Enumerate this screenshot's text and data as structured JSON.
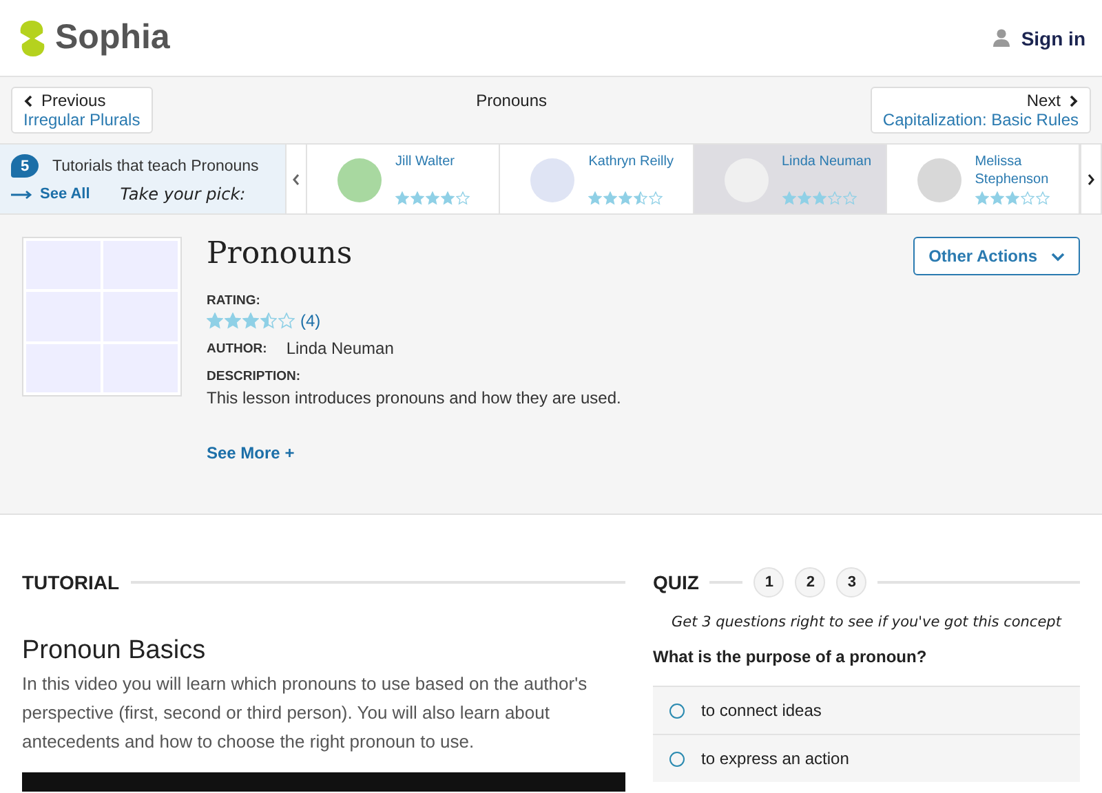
{
  "header": {
    "logo": "Sophia",
    "sign_in": "Sign in"
  },
  "nav": {
    "previous": {
      "label": "Previous",
      "title": "Irregular Plurals"
    },
    "current": "Pronouns",
    "next": {
      "label": "Next",
      "title": "Capitalization: Basic Rules"
    }
  },
  "tutorials": {
    "count": "5",
    "heading": "Tutorials that teach Pronouns",
    "see_all": "See All",
    "tagline": "Take your pick:",
    "items": [
      {
        "author": "Jill Walter",
        "stars": 4,
        "selected": false
      },
      {
        "author": "Kathryn Reilly",
        "stars": 3.5,
        "selected": false
      },
      {
        "author": "Linda Neuman",
        "stars": 3,
        "selected": true
      },
      {
        "author": "Melissa Stephenson",
        "stars": 3,
        "selected": false
      }
    ]
  },
  "lesson": {
    "title": "Pronouns",
    "rating_label": "RATING:",
    "stars": 3.5,
    "rating_count": "(4)",
    "author_label": "AUTHOR:",
    "author": "Linda Neuman",
    "description_label": "DESCRIPTION:",
    "description": "This lesson introduces pronouns and how they are used.",
    "see_more": "See More +",
    "other_actions": "Other Actions"
  },
  "tutorial": {
    "heading": "TUTORIAL",
    "title": "Pronoun Basics",
    "text": "In this video you will learn which pronouns to use based on the author's perspective (first, second or third person). You will also learn about antecedents and how to choose the right pronoun to use."
  },
  "quiz": {
    "heading": "QUIZ",
    "steps": [
      {
        "label": "1",
        "selected": false
      },
      {
        "label": "2",
        "selected": false
      },
      {
        "label": "3",
        "selected": false
      }
    ],
    "tagline": "Get 3 questions right to see if you've got this concept",
    "question": "What is the purpose of a pronoun?",
    "options": [
      {
        "text": "to connect ideas",
        "selected": false
      },
      {
        "text": "to express an action",
        "selected": false
      }
    ]
  }
}
